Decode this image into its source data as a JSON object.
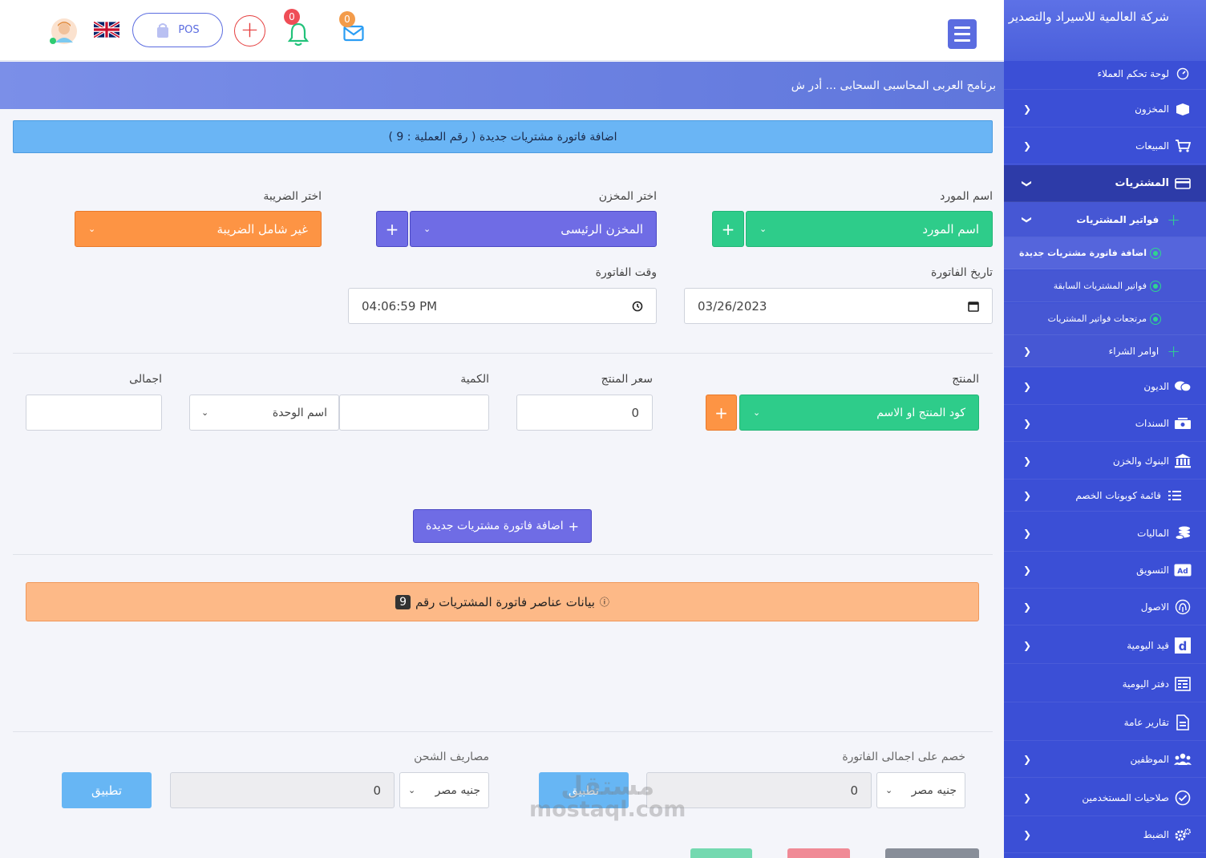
{
  "header": {
    "mail_count": "0",
    "bell_count": "0",
    "pos_label": "POS",
    "language": "EN"
  },
  "title_strip": "برنامج العربى المحاسبى السحابى ... أدر ش",
  "invoice_banner": "اضافة فاتورة مشتريات جديدة ( رقم العملية : 9 )",
  "form": {
    "supplier_label": "اسم المورد",
    "supplier_value": "اسم المورد",
    "store_label": "اختر المخزن",
    "store_value": "المخزن الرئيسى",
    "tax_label": "اختر الضريبة",
    "tax_value": "غير شامل الضريبة",
    "date_label": "تاريخ الفاتورة",
    "date_value": "03/26/2023",
    "time_label": "وقت الفاتورة",
    "time_value": "04:06:59 PM",
    "product_label": "المنتج",
    "product_value": "كود المنتج او الاسم",
    "price_label": "سعر المنتج",
    "price_value": "0",
    "qty_label": "الكمية",
    "unit_value": "اسم الوحدة",
    "total_label": "اجمالى",
    "plus": "+"
  },
  "add_invoice_button": "اضافة فاتورة مشتريات جديدة",
  "items_banner": {
    "text": "بيانات عناصر فاتورة المشتريات رقم",
    "number": "9"
  },
  "discount": {
    "label": "خصم على اجمالى الفاتورة",
    "currency": "جنيه مصر",
    "value": "0",
    "apply": "تطبيق"
  },
  "shipping": {
    "label": "مصاريف الشحن",
    "currency": "جنيه مصر",
    "value": "0",
    "apply": "تطبيق"
  },
  "watermark": {
    "line1": "مستقل",
    "line2": "mostaql.com"
  },
  "sidebar": {
    "brand": "شركة العالمية للاسيراد والتصدير",
    "items": [
      {
        "label": "لوحة تحكم العملاء",
        "icon": "dashboard-icon"
      },
      {
        "label": "المخزون",
        "icon": "box-icon"
      },
      {
        "label": "المبيعات",
        "icon": "cart-icon"
      },
      {
        "label": "المشتريات",
        "icon": "card-icon"
      },
      {
        "label": "فواتير المشتريات",
        "icon": "plus-icon"
      },
      {
        "label": "اضافة فاتورة مشتريات جديدة",
        "icon": "dot-icon"
      },
      {
        "label": "فواتير المشتريات السابقة",
        "icon": "dot-icon"
      },
      {
        "label": "مرتجعات فواتير المشتريات",
        "icon": "dot-icon"
      },
      {
        "label": "اوامر الشراء",
        "icon": "plus-icon"
      },
      {
        "label": "الديون",
        "icon": "chat-icon"
      },
      {
        "label": "السندات",
        "icon": "cash-icon"
      },
      {
        "label": "البنوك والخزن",
        "icon": "bank-icon"
      },
      {
        "label": "قائمة كوبونات الخصم",
        "icon": "list-icon"
      },
      {
        "label": "الماليات",
        "icon": "coins-icon"
      },
      {
        "label": "التسويق",
        "icon": "ad-icon"
      },
      {
        "label": "الاصول",
        "icon": "fingerprint-icon"
      },
      {
        "label": "قيد اليومية",
        "icon": "d-icon"
      },
      {
        "label": "دفتر اليومية",
        "icon": "ledger-icon"
      },
      {
        "label": "تقارير عامة",
        "icon": "report-icon"
      },
      {
        "label": "الموظفين",
        "icon": "users-icon"
      },
      {
        "label": "صلاحيات المستخدمين",
        "icon": "check-icon"
      },
      {
        "label": "الضبط",
        "icon": "gears-icon"
      }
    ]
  },
  "colors": {
    "primary": "#5b6ce0",
    "green": "#2ecc8a",
    "orange": "#fd9444",
    "sky": "#6ab5f5",
    "sidebar": "#3b4fd6"
  }
}
